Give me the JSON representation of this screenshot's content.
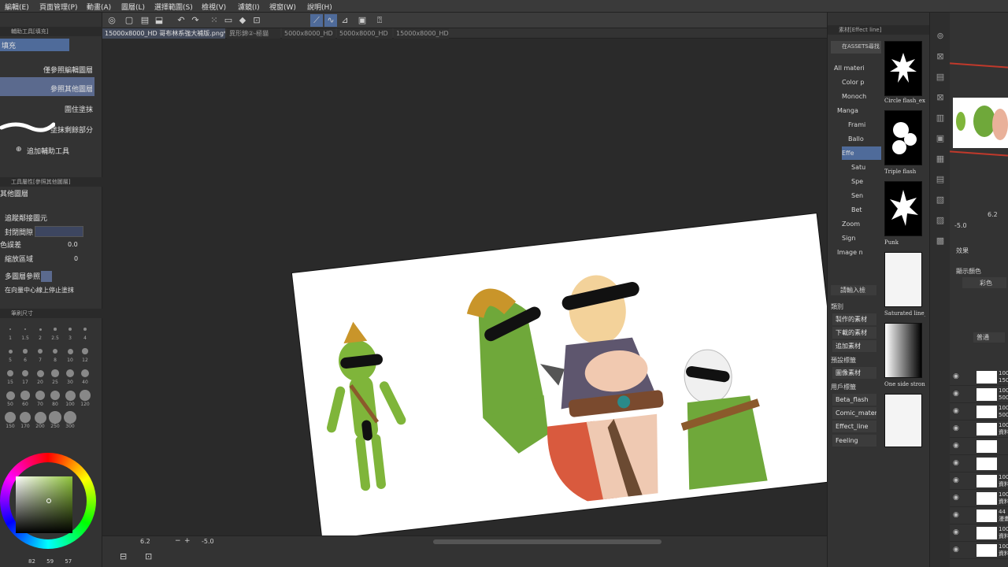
{
  "menu": [
    "編輯(E)",
    "頁面管理(P)",
    "動畫(A)",
    "圖層(L)",
    "選擇範圍(S)",
    "檢視(V)",
    "濾鏡(I)",
    "視窗(W)",
    "說明(H)"
  ],
  "tabs": [
    {
      "label": "15000x8000_HD 哥布林系強大補版.png*",
      "active": true
    },
    {
      "label": "異形錦②-極貓",
      "active": false
    },
    {
      "label": "5000x8000_HD",
      "active": false
    },
    {
      "label": "5000x8000_HD",
      "active": false
    },
    {
      "label": "15000x8000_HD",
      "active": false
    }
  ],
  "left_panel": {
    "sub_tool_header": "輔助工具[填充]",
    "sub_tool_title": "填充",
    "options": [
      "僅參照編輯圖層",
      "參照其他圖層",
      "圍住塗抹",
      "塗抹剩餘部分"
    ],
    "add_tool": "追加輔助工具",
    "props_header": "工具屬性[參照其他圖層]",
    "props_title": "其他圖層",
    "follow_adjacent": "追蹤鄰接圖元",
    "close_gap": "封閉間隙",
    "color_margin": "色誤差",
    "color_margin_value": "0.0",
    "area_scaling": "縮放區域",
    "area_scaling_value": "0",
    "multi_ref": "多圖層參照",
    "stop_center": "在向量中心線上停止塗抹",
    "brush_size_header": "筆刷尺寸",
    "brush_sizes": [
      "1",
      "1.5",
      "2",
      "2.5",
      "3",
      "4",
      "5",
      "6",
      "7",
      "8",
      "10",
      "12",
      "15",
      "17",
      "20",
      "25",
      "30",
      "40",
      "50",
      "60",
      "70",
      "80",
      "100",
      "120",
      "150",
      "170",
      "200",
      "250",
      "300"
    ],
    "color_values": {
      "a": "82",
      "b": "59",
      "c": "57"
    }
  },
  "bottom_bar": {
    "zoom": "6.2",
    "rotation": "-5.0"
  },
  "material_panel": {
    "header": "素材[Effect line]",
    "search_label": "在ASSETS尋找",
    "tree": [
      "All materi",
      "Color p",
      "Monoch",
      "Manga",
      "Frami",
      "Ballo",
      "Effe",
      "Satu",
      "Spe",
      "Sen",
      "Bet",
      "Zoom",
      "Sign",
      "Image n"
    ],
    "thumbs": [
      "Circle flash_ex",
      "Triple flash",
      "Punk",
      "Saturated line_",
      "One side strong"
    ],
    "keyword": "請輸入檢",
    "category_header": "類別",
    "categories": [
      "製作的素材",
      "下載的素材",
      "追加素材"
    ],
    "preset_header": "預設標籤",
    "preset_tags": [
      "圖像素材"
    ],
    "user_header": "用戶標籤",
    "user_tags": [
      "Beta_flash",
      "Comic_materi",
      "Effect_line",
      "Feeling"
    ]
  },
  "far_right": {
    "zoom": "6.2",
    "rotation": "-5.0",
    "effect_label": "效果",
    "display_color": "顯示顏色",
    "color_mode": "彩色",
    "blend": "普通",
    "layers": [
      {
        "l1": "100",
        "l2": "150"
      },
      {
        "l1": "100",
        "l2": "500"
      },
      {
        "l1": "100",
        "l2": "500"
      },
      {
        "l1": "100",
        "l2": "資料"
      },
      {
        "l1": "",
        "l2": ""
      },
      {
        "l1": "",
        "l2": ""
      },
      {
        "l1": "100",
        "l2": "資料"
      },
      {
        "l1": "100",
        "l2": "資料"
      },
      {
        "l1": "44",
        "l2": "漫畫"
      },
      {
        "l1": "100",
        "l2": "資料"
      },
      {
        "l1": "100",
        "l2": "資料"
      }
    ]
  }
}
